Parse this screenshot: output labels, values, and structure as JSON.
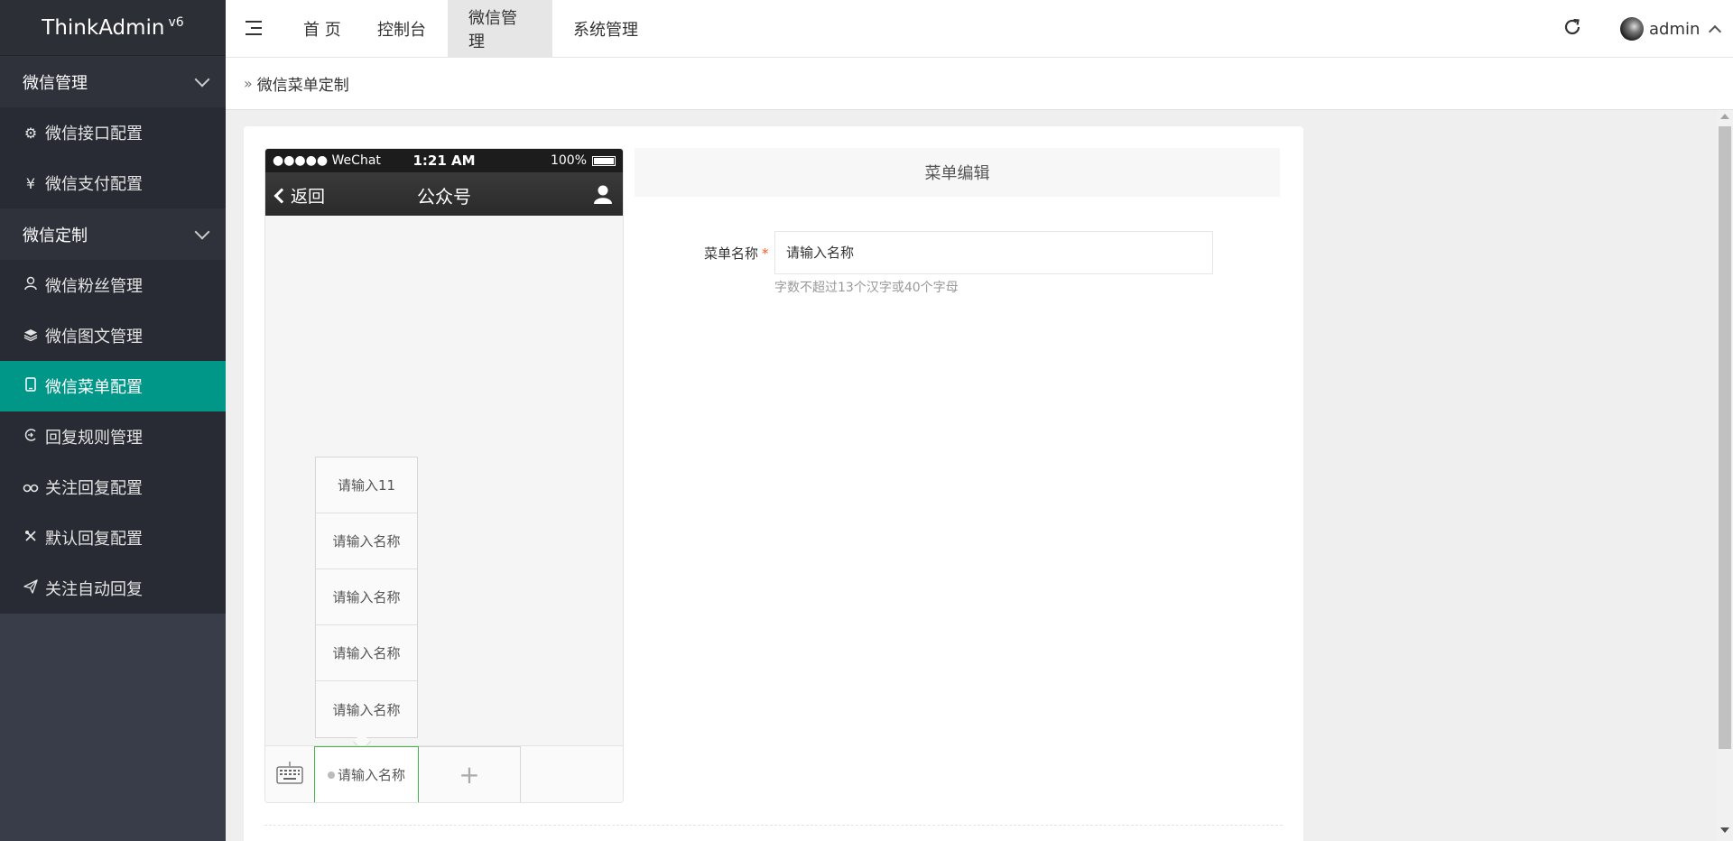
{
  "app": {
    "name": "ThinkAdmin",
    "version": "v6"
  },
  "sidebar": {
    "groups": [
      {
        "label": "微信管理",
        "items": [
          {
            "label": "微信接口配置",
            "icon": "gear-icon"
          },
          {
            "label": "微信支付配置",
            "icon": "yen-icon"
          }
        ]
      },
      {
        "label": "微信定制",
        "items": [
          {
            "label": "微信粉丝管理",
            "icon": "user-icon"
          },
          {
            "label": "微信图文管理",
            "icon": "layers-icon"
          },
          {
            "label": "微信菜单配置",
            "icon": "mobile-icon",
            "active": true
          },
          {
            "label": "回复规则管理",
            "icon": "reply-icon"
          },
          {
            "label": "关注回复配置",
            "icon": "link-icon"
          },
          {
            "label": "默认回复配置",
            "icon": "tools-icon"
          },
          {
            "label": "关注自动回复",
            "icon": "send-icon"
          }
        ]
      }
    ]
  },
  "topbar": {
    "tabs": [
      "首 页",
      "控制台",
      "微信管理",
      "系统管理"
    ],
    "active_tab": "微信管理",
    "user": "admin"
  },
  "breadcrumb": {
    "title": "微信菜单定制"
  },
  "phone": {
    "carrier": "●●●●● WeChat",
    "time": "1:21 AM",
    "battery": "100%",
    "back_label": "返回",
    "title": "公众号",
    "sub_menu": [
      "请输入11",
      "请输入名称",
      "请输入名称",
      "请输入名称",
      "请输入名称"
    ],
    "main_menu_label": "请输入名称",
    "add_label": "+"
  },
  "editor": {
    "header": "菜单编辑",
    "field_label": "菜单名称",
    "required_mark": "*",
    "placeholder": "请输入名称",
    "help": "字数不超过13个汉字或40个字母"
  },
  "colors": {
    "accent": "#009688",
    "sidebar": "#393d49",
    "wechat_green": "#44b549"
  }
}
